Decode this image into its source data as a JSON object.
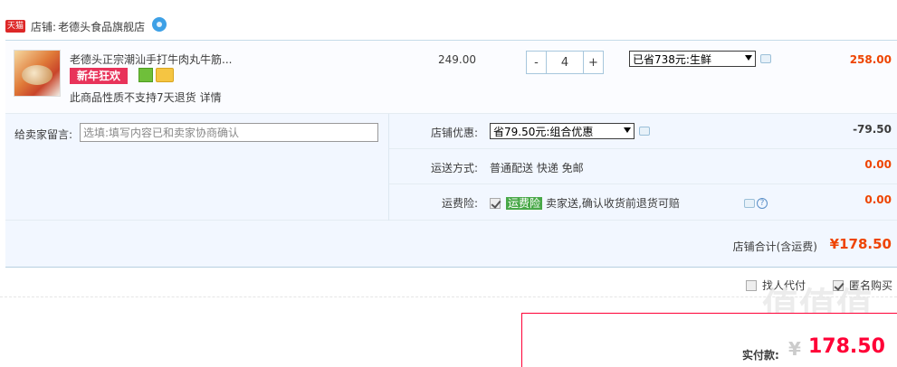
{
  "shop": {
    "badge": "天猫",
    "label": "店铺:",
    "name": "老德头食品旗舰店"
  },
  "item": {
    "title": "老德头正宗潮汕手打牛肉丸牛筋...",
    "promo_tag": "新年狂欢",
    "return_note": "此商品性质不支持7天退货",
    "detail_link": "详情",
    "unit_price": "249.00",
    "quantity": "4",
    "minus_label": "-",
    "plus_label": "+",
    "discount_select": "已省738元:生鲜",
    "total": "258.00"
  },
  "options": {
    "memo_label": "给卖家留言:",
    "memo_placeholder": "选填:填写内容已和卖家协商确认",
    "coupon_label": "店铺优惠:",
    "coupon_select": "省79.50元:组合优惠",
    "coupon_value": "-79.50",
    "shipping_label": "运送方式:",
    "shipping_text": "普通配送 快递 免邮",
    "shipping_value": "0.00",
    "insurance_label": "运费险:",
    "insurance_badge": "运费险",
    "insurance_text": "卖家送,确认收货前退货可赔",
    "insurance_value": "0.00"
  },
  "shop_total": {
    "label": "店铺合计(含运费)",
    "value": "¥178.50"
  },
  "extra": {
    "proxy_pay": "找人代付",
    "anonymous": "匿名购买"
  },
  "payment": {
    "label": "实付款:",
    "currency": "¥",
    "value": "178.50"
  },
  "watermark": "值值值",
  "colors": {
    "price_red": "#ee4400",
    "pay_red": "#ff0036",
    "promo_pink": "#e8335a",
    "panel_blue": "#f2f7ff"
  }
}
